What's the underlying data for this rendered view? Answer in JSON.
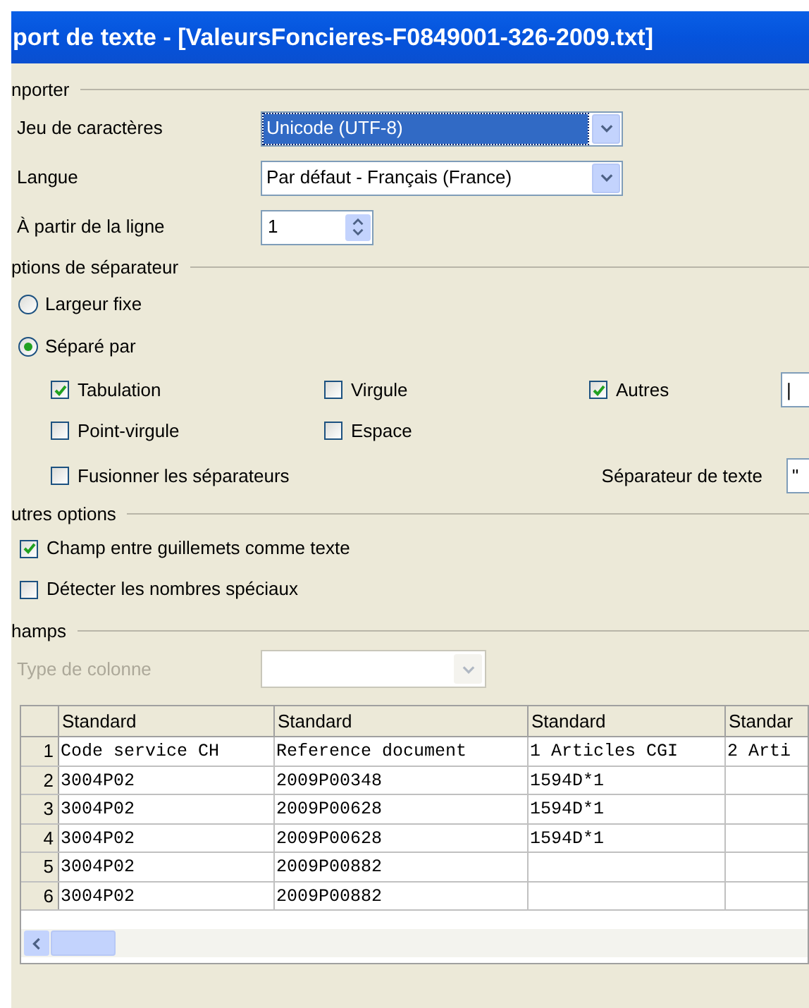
{
  "window": {
    "title": "port de texte - [ValeursFoncieres-F0849001-326-2009.txt]"
  },
  "import": {
    "legend": "nporter",
    "fields": [
      {
        "label": "Jeu de caractères",
        "kind": "dropdown",
        "value": "Unicode (UTF-8)",
        "focused": true
      },
      {
        "label": "Langue",
        "kind": "dropdown",
        "value": "Par défaut - Français (France)",
        "focused": false
      },
      {
        "label": "À partir de la ligne",
        "kind": "spin",
        "value": "1"
      }
    ]
  },
  "separator_options": {
    "legend": "ptions de séparateur",
    "modes": [
      {
        "label": "Largeur fixe",
        "selected": false
      },
      {
        "label": "Séparé par",
        "selected": true
      }
    ],
    "separators": [
      {
        "label": "Tabulation",
        "checked": true
      },
      {
        "label": "Virgule",
        "checked": false
      },
      {
        "label": "Autres",
        "checked": true,
        "value": "|"
      },
      {
        "label": "Point-virgule",
        "checked": false
      },
      {
        "label": "Espace",
        "checked": false
      }
    ],
    "merge": {
      "label": "Fusionner les séparateurs",
      "checked": false
    },
    "text_delimiter": {
      "label": "Séparateur de texte",
      "value": "\""
    }
  },
  "other_options": {
    "legend": "utres options",
    "options": [
      {
        "label": "Champ entre guillemets comme texte",
        "checked": true
      },
      {
        "label": "Détecter les nombres spéciaux",
        "checked": false
      }
    ]
  },
  "fields": {
    "legend": "hamps",
    "column_type": {
      "label": "Type de colonne",
      "disabled": true
    },
    "table": {
      "columns": [
        "Standard",
        "Standard",
        "Standard",
        "Standar"
      ],
      "rows": [
        {
          "number": "1",
          "cells": [
            "Code service CH",
            "Reference document",
            "1 Articles CGI",
            "2 Arti"
          ]
        },
        {
          "number": "2",
          "cells": [
            "3004P02",
            "2009P00348",
            "1594D*1",
            ""
          ]
        },
        {
          "number": "3",
          "cells": [
            "3004P02",
            "2009P00628",
            "1594D*1",
            ""
          ]
        },
        {
          "number": "4",
          "cells": [
            "3004P02",
            "2009P00628",
            "1594D*1",
            ""
          ]
        },
        {
          "number": "5",
          "cells": [
            "3004P02",
            "2009P00882",
            "",
            ""
          ]
        },
        {
          "number": "6",
          "cells": [
            "3004P02",
            "2009P00882",
            "",
            ""
          ]
        }
      ]
    }
  }
}
